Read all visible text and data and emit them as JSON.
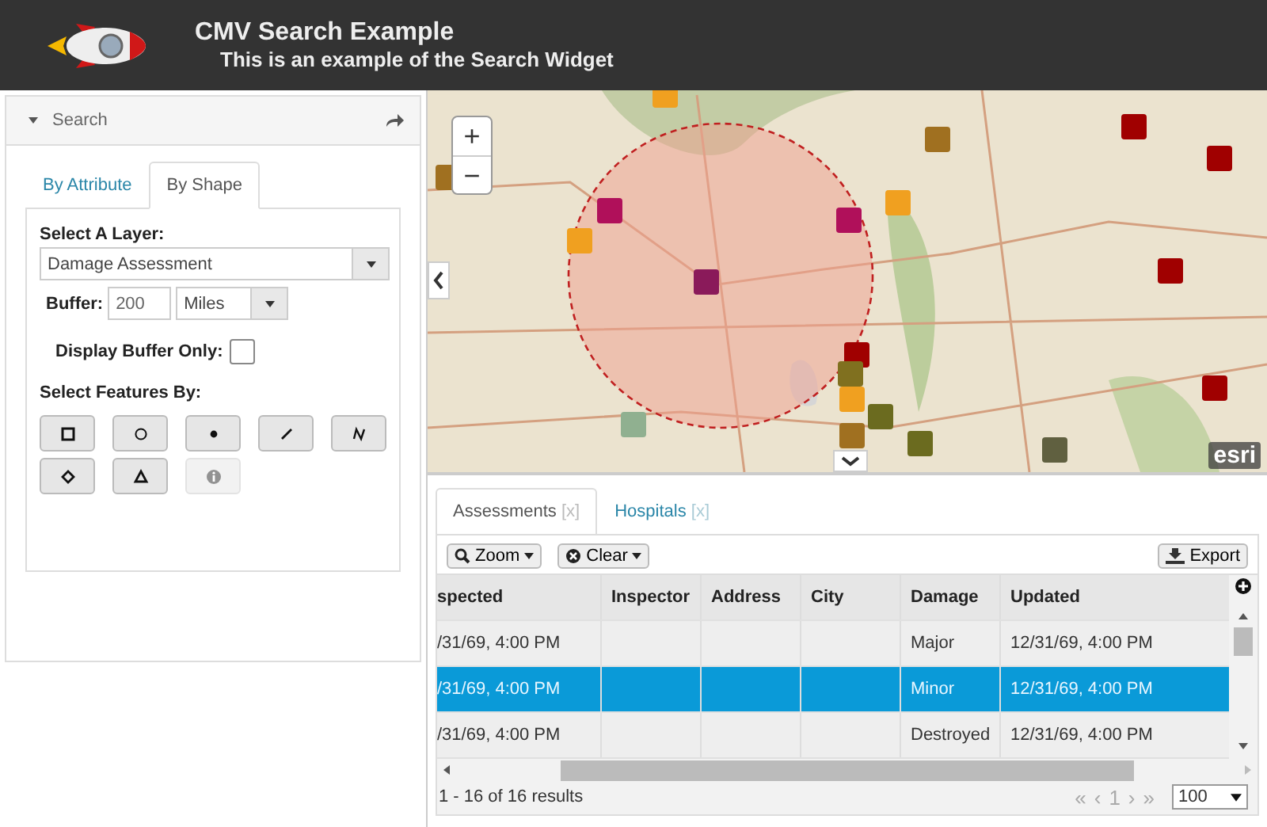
{
  "header": {
    "title": "CMV Search Example",
    "subtitle": "This is an example of the Search Widget"
  },
  "search_panel": {
    "title": "Search",
    "expanded": true,
    "tabs": [
      {
        "label": "By Attribute",
        "selected": false
      },
      {
        "label": "By Shape",
        "selected": true
      }
    ],
    "layer": {
      "label": "Select A Layer:",
      "value": "Damage Assessment"
    },
    "buffer": {
      "label": "Buffer:",
      "value": "200",
      "unit": "Miles"
    },
    "buffer_only": {
      "label": "Display Buffer Only:",
      "checked": false
    },
    "select_by": {
      "label": "Select Features By:",
      "tools": [
        {
          "kind": "rectangle",
          "disabled": false
        },
        {
          "kind": "circle",
          "disabled": false
        },
        {
          "kind": "point",
          "disabled": false
        },
        {
          "kind": "line",
          "disabled": false
        },
        {
          "kind": "freehand",
          "disabled": false
        },
        {
          "kind": "polygon",
          "disabled": false
        },
        {
          "kind": "triangle",
          "disabled": false
        },
        {
          "kind": "info",
          "disabled": true
        }
      ]
    }
  },
  "map": {
    "kind": "picture",
    "zoom_in": "+",
    "zoom_out": "−",
    "attribution": "esri"
  },
  "results": {
    "tabs": [
      {
        "label": "Assessments",
        "close": "[x]",
        "selected": true
      },
      {
        "label": "Hospitals",
        "close": "[x]",
        "selected": false
      }
    ],
    "toolbar": {
      "zoom": "Zoom",
      "clear": "Clear",
      "export": "Export"
    },
    "table": {
      "columns": [
        "spected",
        "Inspector",
        "Address",
        "City",
        "Damage",
        "Updated"
      ],
      "rows": [
        {
          "cells": [
            "/31/69, 4:00 PM",
            "",
            "",
            "",
            "Major",
            "12/31/69, 4:00 PM"
          ],
          "selected": false
        },
        {
          "cells": [
            "/31/69, 4:00 PM",
            "",
            "",
            "",
            "Minor",
            "12/31/69, 4:00 PM"
          ],
          "selected": true
        },
        {
          "cells": [
            "/31/69, 4:00 PM",
            "",
            "",
            "",
            "Destroyed",
            "12/31/69, 4:00 PM"
          ],
          "selected": false
        }
      ]
    },
    "footer": {
      "summary": "1 - 16 of 16 results",
      "first": "«",
      "prev": "‹",
      "page": "1",
      "next": "›",
      "last": "»",
      "page_size": "100"
    }
  }
}
